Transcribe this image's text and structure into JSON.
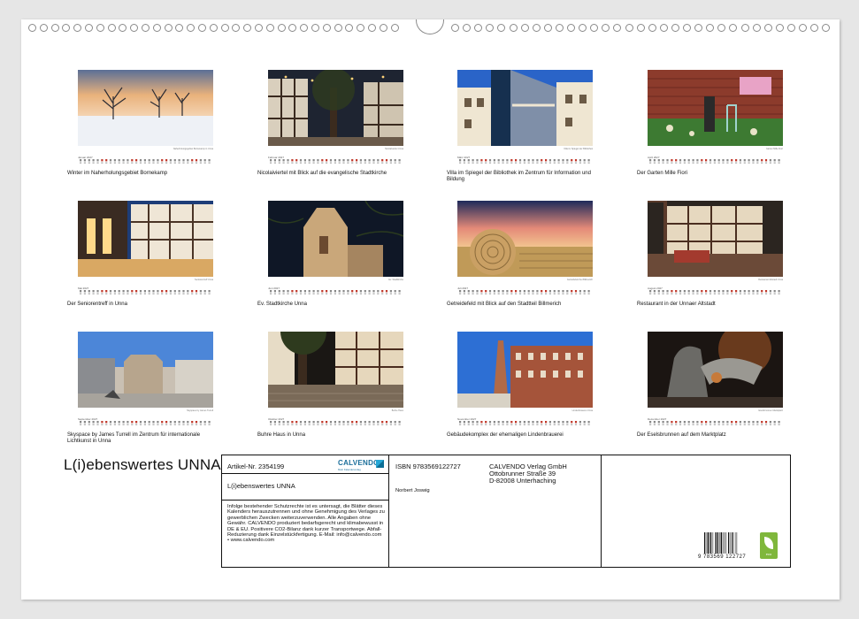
{
  "calendar_title": "L(i)ebenswertes UNNA",
  "months": [
    {
      "name": "Januar 2027",
      "caption": "Winter im Naherholungsgebiet Bornekamp",
      "credit": "Naherholungsgebiet Bornekamp in Unna"
    },
    {
      "name": "Februar 2027",
      "caption": "Nicolaiviertel mit Blick auf die evangelische Stadtkirche",
      "credit": "Nicolaiviertel Unna"
    },
    {
      "name": "März 2027",
      "caption": "Villa im Spiegel der Bibliothek im Zentrum für Information und Bildung",
      "credit": "Villa im Spiegel der Bibliothek"
    },
    {
      "name": "April 2027",
      "caption": "Der Garten Mille Fiori",
      "credit": "Garten Mille Fiori"
    },
    {
      "name": "Mai 2027",
      "caption": "Der Seniorentreff in Unna",
      "credit": "Seniorentreff Unna"
    },
    {
      "name": "Juni 2027",
      "caption": "Ev. Stadtkirche Unna",
      "credit": "Ev. Stadtkirche"
    },
    {
      "name": "Juli 2027",
      "caption": "Getreidefeld mit Blick auf den Stadtteil Billmerich",
      "credit": "Getreidefeld bei Billmerich"
    },
    {
      "name": "August 2027",
      "caption": "Restaurant in der Unnaer Altstadt",
      "credit": "Restaurant Altstadt Unna"
    },
    {
      "name": "September 2027",
      "caption": "Skyspace by James Turrell im Zentrum für internationale Lichtkunst in Unna",
      "credit": "Skyspace by James Turrell"
    },
    {
      "name": "Oktober 2027",
      "caption": "Buhre Haus in Unna",
      "credit": "Buhre Haus"
    },
    {
      "name": "November 2027",
      "caption": "Gebäudekomplex der ehemaligen Lindenbrauerei",
      "credit": "Lindenbrauerei Unna"
    },
    {
      "name": "Dezember 2027",
      "caption": "Der Eselsbrunnen auf dem Marktplatz",
      "credit": "Eselsbrunnen Marktplatz"
    }
  ],
  "info": {
    "article_label": "Artikel-Nr. 2354199",
    "logo_word": "CALVENDO",
    "logo_sub": "Mein Kalenderverlag",
    "product_title": "L(i)ebenswertes UNNA",
    "legal_text": "Infolge bestehender Schutzrechte ist es untersagt, die Blätter dieses Kalenders herauszutrennen und ohne Genehmigung des Verlages zu gewerblichen Zwecken weiterzuverwenden. Alle Angaben ohne Gewähr. CALVENDO produziert bedarfsgerecht und klimabewusst in DE & EU. Positivere CO2-Bilanz dank kurzer Transportwege. Abfall-Reduzierung dank Einzelstückfertigung. E-Mail: info@calvendo.com • www.calvendo.com",
    "isbn": "ISBN 9783569122727",
    "publisher_lines": [
      "CALVENDO Verlag GmbH",
      "Ottobrunner Straße 39",
      "D-82008 Unterhaching"
    ],
    "author": "Norbert Joswig",
    "barcode_number": "9 783569 122727",
    "eco_label": "eco"
  }
}
